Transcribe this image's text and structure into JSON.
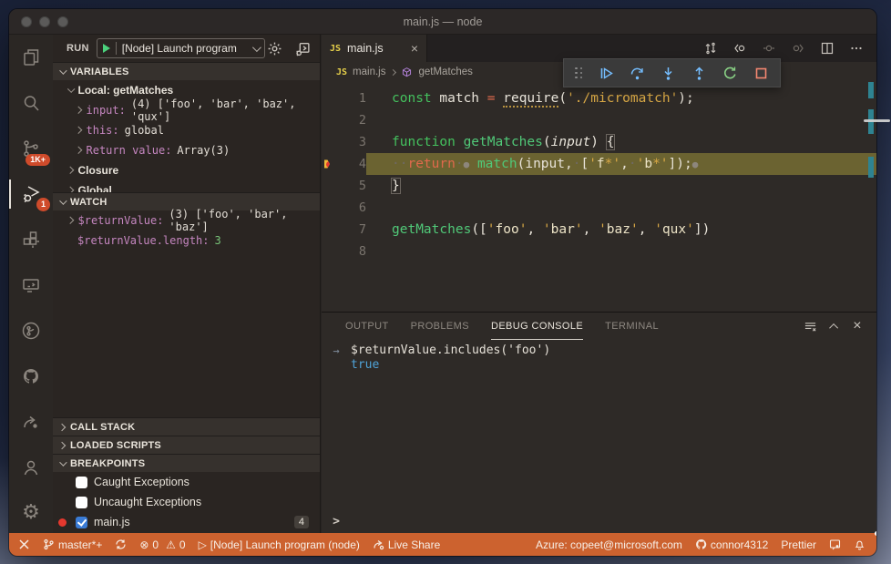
{
  "colors": {
    "status_bar_debugging": "#cc622f",
    "activity_badge": "#cf4b2b",
    "current_line_highlight": "#6b6331",
    "breakpoint_red": "#e5382e",
    "debug_blue": "#75beff",
    "restart_green": "#89d185",
    "stop_red": "#f48771",
    "keyword_green": "#44c15e",
    "string_gold": "#d8a845",
    "variable_name_mauve": "#c586c0",
    "result_blue": "#4fa3d8",
    "overview_mark_teal": "#2e8391"
  },
  "titlebar": {
    "title": "main.js — node"
  },
  "run_bar": {
    "run_label": "RUN",
    "config_label": "[Node] Launch program"
  },
  "activity_bar": {
    "source_control_badge": "1K+",
    "debug_badge": "1"
  },
  "sidebar": {
    "variables": {
      "header": "VARIABLES",
      "scope": "Local: getMatches",
      "rows": [
        {
          "name": "input:",
          "value": "(4) ['foo', 'bar', 'baz', 'qux']"
        },
        {
          "name": "this:",
          "value": "global"
        },
        {
          "name": "Return value:",
          "value": "Array(3)"
        }
      ],
      "closure": "Closure",
      "global": "Global"
    },
    "watch": {
      "header": "WATCH",
      "rows": [
        {
          "name": "$returnValue:",
          "value": "(3) ['foo', 'bar', 'baz']"
        },
        {
          "name": "$returnValue.length:",
          "value": "3"
        }
      ]
    },
    "call_stack": {
      "header": "CALL STACK"
    },
    "loaded_scripts": {
      "header": "LOADED SCRIPTS"
    },
    "breakpoints": {
      "header": "BREAKPOINTS",
      "badge": "4",
      "items": [
        {
          "label": "Caught Exceptions",
          "checked": false,
          "breakpoint": false
        },
        {
          "label": "Uncaught Exceptions",
          "checked": false,
          "breakpoint": false
        },
        {
          "label": "main.js",
          "checked": true,
          "breakpoint": true
        }
      ]
    }
  },
  "editor": {
    "tab": {
      "label": "main.js",
      "close": "×"
    },
    "breadcrumb": {
      "file": "main.js",
      "symbol": "getMatches"
    },
    "code": {
      "lines": [
        {
          "n": "1",
          "tokens": [
            [
              "kw",
              "const"
            ],
            [
              "plain",
              " match "
            ],
            [
              "op",
              "="
            ],
            [
              "plain",
              " "
            ],
            [
              "req",
              "require"
            ],
            [
              "plain",
              "("
            ],
            [
              "str",
              "'./micromatch'"
            ],
            [
              "plain",
              ");"
            ]
          ]
        },
        {
          "n": "2",
          "tokens": []
        },
        {
          "n": "3",
          "tokens": [
            [
              "kw",
              "function"
            ],
            [
              "plain",
              " "
            ],
            [
              "fn",
              "getMatches"
            ],
            [
              "plain",
              "("
            ],
            [
              "param",
              "input"
            ],
            [
              "plain",
              ") "
            ],
            [
              "brkt",
              "{"
            ]
          ]
        },
        {
          "n": "4",
          "current": true,
          "breakpoint_arrow": true,
          "tokens": [
            [
              "ws",
              "··"
            ],
            [
              "ret",
              "return"
            ],
            [
              "ws",
              "·"
            ],
            [
              "bpdot",
              "●"
            ],
            [
              "plain",
              " "
            ],
            [
              "fn",
              "match"
            ],
            [
              "plain",
              "(input,"
            ],
            [
              "ws",
              "·"
            ],
            [
              "plain",
              "["
            ],
            [
              "str",
              "'"
            ],
            [
              "strl",
              "f"
            ],
            [
              "str",
              "*'"
            ],
            [
              "plain",
              ","
            ],
            [
              "ws",
              "·"
            ],
            [
              "str",
              "'"
            ],
            [
              "strl",
              "b"
            ],
            [
              "str",
              "*'"
            ],
            [
              "plain",
              "]);"
            ],
            [
              "bpdot",
              "●"
            ]
          ]
        },
        {
          "n": "5",
          "tokens": [
            [
              "brkt",
              "}"
            ]
          ]
        },
        {
          "n": "6",
          "tokens": []
        },
        {
          "n": "7",
          "tokens": [
            [
              "fn",
              "getMatches"
            ],
            [
              "plain",
              "(["
            ],
            [
              "str",
              "'"
            ],
            [
              "strl",
              "foo"
            ],
            [
              "str",
              "'"
            ],
            [
              "plain",
              ", "
            ],
            [
              "str",
              "'"
            ],
            [
              "strl",
              "bar"
            ],
            [
              "str",
              "'"
            ],
            [
              "plain",
              ", "
            ],
            [
              "str",
              "'"
            ],
            [
              "strl",
              "baz"
            ],
            [
              "str",
              "'"
            ],
            [
              "plain",
              ", "
            ],
            [
              "str",
              "'"
            ],
            [
              "strl",
              "qux"
            ],
            [
              "str",
              "'"
            ],
            [
              "plain",
              "])"
            ]
          ]
        },
        {
          "n": "8",
          "tokens": []
        }
      ]
    }
  },
  "panel": {
    "tabs": [
      {
        "label": "OUTPUT",
        "active": false
      },
      {
        "label": "PROBLEMS",
        "active": false
      },
      {
        "label": "DEBUG CONSOLE",
        "active": true
      },
      {
        "label": "TERMINAL",
        "active": false
      }
    ],
    "console": {
      "input_marker": "→",
      "expression": "$returnValue.includes('foo')",
      "result": "true",
      "prompt": ">"
    }
  },
  "status_bar": {
    "branch": "master*+",
    "errors": "0",
    "warnings": "0",
    "error_glyph": "⊗",
    "warning_glyph": "⚠",
    "play_glyph": "▷",
    "launch": "[Node] Launch program (node)",
    "live_share": "Live Share",
    "azure": "Azure: copeet@microsoft.com",
    "account": "connor4312",
    "prettier": "Prettier"
  }
}
